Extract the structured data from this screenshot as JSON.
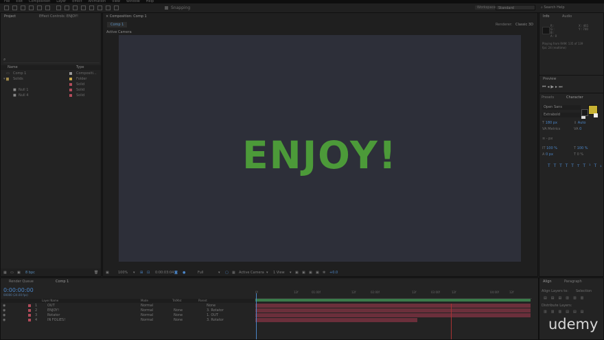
{
  "menu": [
    "File",
    "Edit",
    "Composition",
    "Layer",
    "Effect",
    "Animation",
    "View",
    "Window",
    "Help"
  ],
  "toolbar": {
    "snapping": "Snapping",
    "workspace_label": "Workspace:",
    "workspace_value": "Standard",
    "search_placeholder": "Search Help"
  },
  "project_panel": {
    "tabs": [
      "Project",
      "Effect Controls: ENJOY!"
    ],
    "columns": [
      "Name",
      "Type"
    ],
    "items": [
      {
        "name": "Comp 1",
        "type": "Compositi...",
        "color": "#9a9a9a"
      },
      {
        "name": "Solids",
        "type": "Folder",
        "color": "#c8a84a"
      },
      {
        "name": "",
        "type": "Solid",
        "color": "#b24b5a"
      },
      {
        "name": "Null 1",
        "type": "Solid",
        "color": "#b24b5a"
      },
      {
        "name": "Null 4",
        "type": "Solid",
        "color": "#b24b5a"
      }
    ],
    "footer_depth": "8 bpc"
  },
  "composition_panel": {
    "tab": "Composition: Comp 1",
    "comp_button": "Comp 1",
    "renderer_label": "Renderer:",
    "renderer_value": "Classic 3D",
    "view_label": "Active Camera",
    "display_text": "ENJOY!",
    "display_text_color": "#4c9a39",
    "viewer_bg": "#2d2f39",
    "bottom_bar": {
      "zoom": "100%",
      "timecode": "0:00:03:04",
      "resolution": "Full",
      "camera": "Active Camera",
      "views": "1 View",
      "exposure": "+0.0"
    }
  },
  "right_panel": {
    "info_tabs": [
      "Info",
      "Audio"
    ],
    "info_values": {
      "r": "R :",
      "g": "G :",
      "b": "B :",
      "a": "A : 0",
      "x": "X : 461",
      "y": "Y : 740"
    },
    "info_note": "Playing from RAM: 135 of 139",
    "info_fps": "fps: 24 (realtime)",
    "preview_tab": "Preview",
    "presets_tab": "Presets",
    "character_tab": "Character",
    "font_family": "Open Sans",
    "font_style": "Extrabold",
    "font_size": "180 px",
    "leading": "Auto",
    "tracking_label": "Metrics",
    "tracking_value": "0",
    "stroke_width": "- px",
    "vertical_scale": "100 %",
    "horizontal_scale": "100 %",
    "baseline": "0 px",
    "tsume": "0 %",
    "text_color": "#c7b233"
  },
  "timeline_panel": {
    "tabs": [
      "Render Queue",
      "Comp 1"
    ],
    "timecode": "0:00:00:00",
    "frame_info": "00000 (24.00 fps)",
    "columns": {
      "name": "Layer Name",
      "mode": "Mode",
      "trkmat": "TrkMat",
      "parent": "Parent"
    },
    "layers": [
      {
        "num": "1",
        "name": "OUT",
        "mode": "Normal",
        "trkmat": "",
        "parent": "None"
      },
      {
        "num": "2",
        "name": "ENJOY!",
        "mode": "Normal",
        "trkmat": "None",
        "parent": "3. Rotator"
      },
      {
        "num": "3",
        "name": "Rotator",
        "mode": "Normal",
        "trkmat": "None",
        "parent": "1. OUT"
      },
      {
        "num": "4",
        "name": "IN FOLIES!",
        "mode": "Normal",
        "trkmat": "None",
        "parent": "3. Rotator"
      }
    ],
    "ruler": [
      "0f",
      "12f",
      "01:00f",
      "12f",
      "02:00f",
      "12f",
      "03:00f",
      "12f",
      "04:00f",
      "12f"
    ]
  },
  "align_panel": {
    "tabs": [
      "Align",
      "Paragraph"
    ],
    "align_label": "Align Layers to:",
    "align_value": "Selection",
    "distribute_label": "Distribute Layers:"
  },
  "watermark": "udemy"
}
